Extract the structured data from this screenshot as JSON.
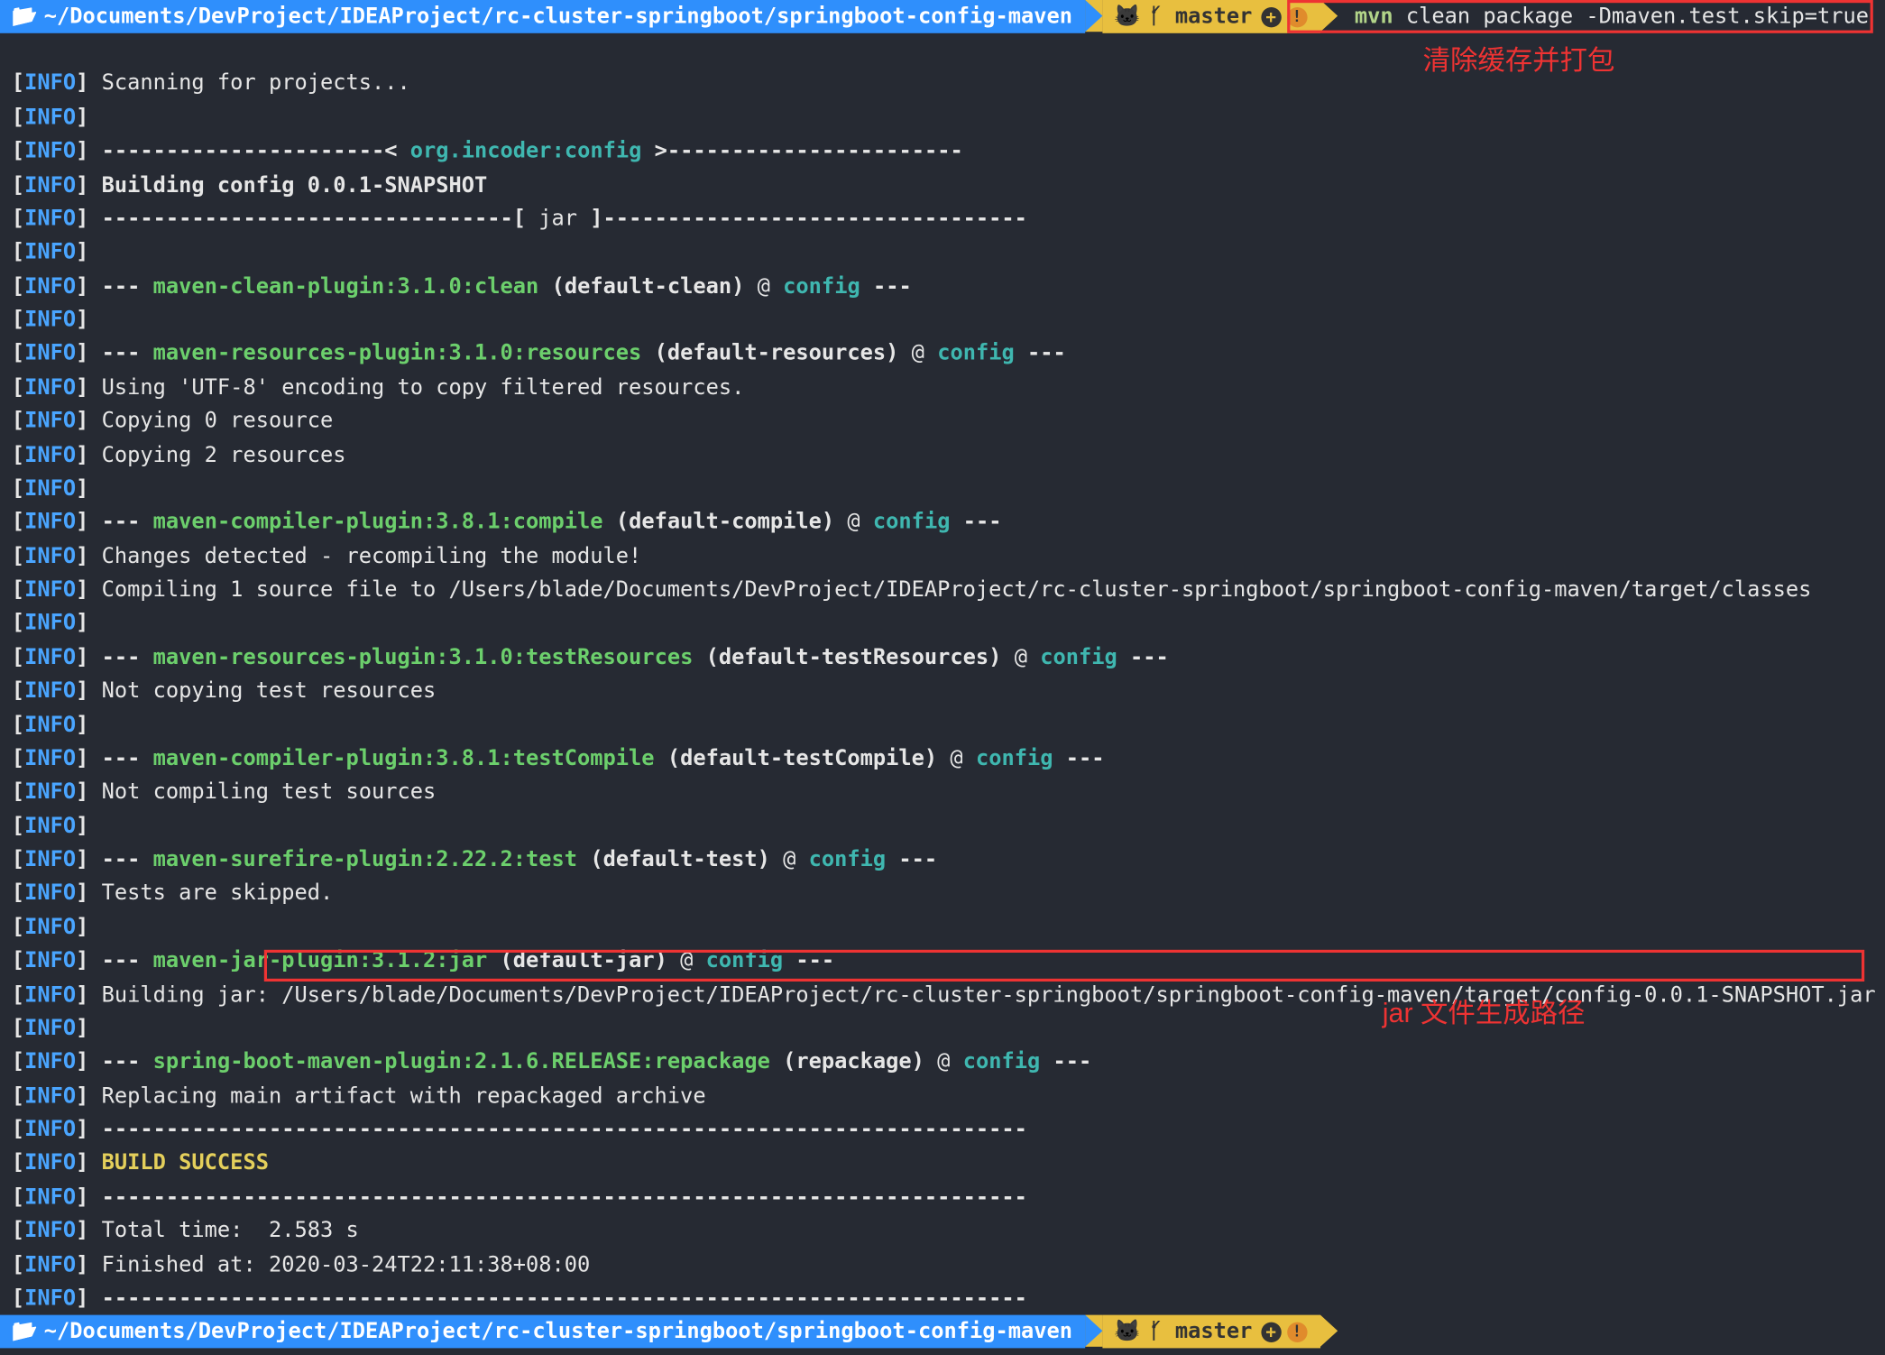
{
  "prompt": {
    "path": "~/Documents/DevProject/IDEAProject/rc-cluster-springboot/springboot-config-maven",
    "branch": "master",
    "command_mvn": "mvn",
    "command_rest": " clean package -Dmaven.test.skip=true"
  },
  "annot": {
    "top": "清除缓存并打包",
    "jar": "jar 文件生成路径"
  },
  "lines": {
    "l1": "Scanning for projects...",
    "l_hr_a": "----------------------",
    "l_artifact": "org.incoder:config",
    "l_hr_b": "-----------------------",
    "l_build": "Building config 0.0.1-SNAPSHOT",
    "l_jar_pre": "--------------------------------[ ",
    "l_jar_mid": "jar",
    "l_jar_post": " ]---------------------------------",
    "dash3": "--- ",
    "dash3e": " ---",
    "at": " @ ",
    "p_clean": "maven-clean-plugin:3.1.0:clean",
    "p_clean_d": "(default-clean)",
    "p_res": "maven-resources-plugin:3.1.0:resources",
    "p_res_d": "(default-resources)",
    "p_res_l1": "Using 'UTF-8' encoding to copy filtered resources.",
    "p_res_l2": "Copying 0 resource",
    "p_res_l3": "Copying 2 resources",
    "p_comp": "maven-compiler-plugin:3.8.1:compile",
    "p_comp_d": "(default-compile)",
    "p_comp_l1": "Changes detected - recompiling the module!",
    "p_comp_l2": "Compiling 1 source file to /Users/blade/Documents/DevProject/IDEAProject/rc-cluster-springboot/springboot-config-maven/target/classes",
    "p_tres": "maven-resources-plugin:3.1.0:testResources",
    "p_tres_d": "(default-testResources)",
    "p_tres_l1": "Not copying test resources",
    "p_tcomp": "maven-compiler-plugin:3.8.1:testCompile",
    "p_tcomp_d": "(default-testCompile)",
    "p_tcomp_l1": "Not compiling test sources",
    "p_sure": "maven-surefire-plugin:2.22.2:test",
    "p_sure_d": "(default-test)",
    "p_sure_l1": "Tests are skipped.",
    "p_jar": "maven-jar-plugin:3.1.2:jar",
    "p_jar_d": "(default-jar)",
    "p_jar_l1a": "Building jar: ",
    "p_jar_l1b": "/Users/blade/Documents/DevProject/IDEAProject/rc-cluster-springboot/springboot-config-maven/target/config-0.0.1-SNAPSHOT.jar",
    "p_boot": "spring-boot-maven-plugin:2.1.6.RELEASE:repackage",
    "p_boot_d": "(repackage)",
    "p_boot_l1": "Replacing main artifact with repackaged archive",
    "hr": "------------------------------------------------------------------------",
    "success": "BUILD SUCCESS",
    "time": "Total time:  2.583 s",
    "finished": "Finished at: 2020-03-24T22:11:38+08:00",
    "cfg": "config"
  }
}
